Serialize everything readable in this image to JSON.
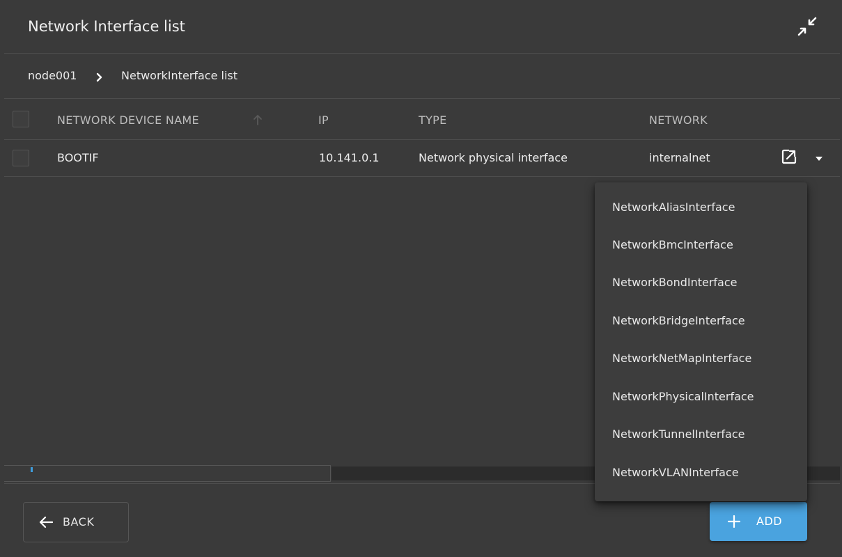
{
  "header": {
    "title": "Network Interface list",
    "collapse_icon": "collapse-arrows-icon"
  },
  "breadcrumb": {
    "root": "node001",
    "separator_icon": "chevron-right-icon",
    "current": "NetworkInterface list"
  },
  "table": {
    "columns": [
      "NETWORK DEVICE NAME",
      "IP",
      "TYPE",
      "NETWORK"
    ],
    "sort_icon": "arrow-up-icon",
    "rows": [
      {
        "name": "BOOTIF",
        "ip": "10.141.0.1",
        "type": "Network physical interface",
        "network": "internalnet"
      }
    ],
    "row_action_icons": [
      "open-in-new-icon",
      "caret-down-icon"
    ]
  },
  "dropdown": {
    "items": [
      "NetworkAliasInterface",
      "NetworkBmcInterface",
      "NetworkBondInterface",
      "NetworkBridgeInterface",
      "NetworkNetMapInterface",
      "NetworkPhysicalInterface",
      "NetworkTunnelInterface",
      "NetworkVLANInterface"
    ]
  },
  "footer": {
    "back_label": "BACK",
    "add_label": "ADD"
  },
  "colors": {
    "background": "#3a3a3a",
    "accent": "#4aa3df",
    "divider": "#4d4d4d",
    "menu": "#3d3d3d"
  }
}
